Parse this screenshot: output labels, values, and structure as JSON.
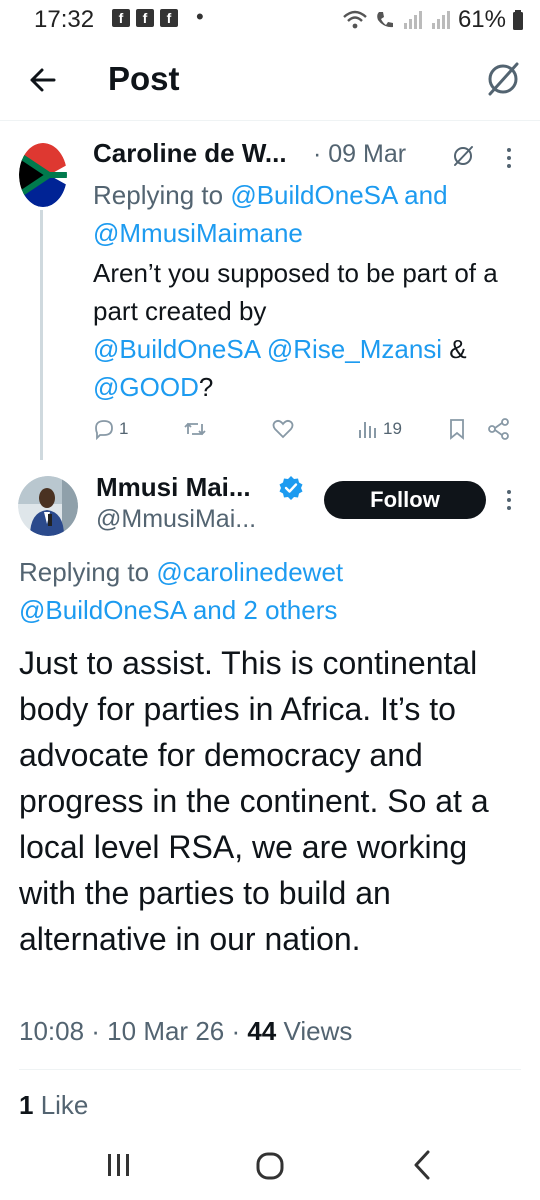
{
  "status_bar": {
    "time": "17:32",
    "notification_icons": [
      "f",
      "f",
      "f"
    ],
    "dot": "•",
    "battery": "61%"
  },
  "header": {
    "back_icon": "arrow-left-icon",
    "title": "Post",
    "grok_icon": "grok-icon"
  },
  "reply_tweet": {
    "author_name": "Caroline de W...",
    "date": "· 09 Mar",
    "replying_prefix": "Replying to ",
    "replying_to_1": "@BuildOneSA",
    "replying_and": " and",
    "replying_to_2": "@MmusiMaimane",
    "body_text": "Aren’t you supposed to be part of a part created by",
    "mention_1": "@BuildOneSA",
    "mention_2": "@Rise_Mzansi",
    "amp": " &",
    "mention_3": "@GOOD",
    "question": "?",
    "actions": {
      "replies": "1",
      "views": "19"
    }
  },
  "main_tweet": {
    "author_name": "Mmusi Mai...",
    "handle": "@MmusiMai...",
    "follow_label": "Follow",
    "replying_prefix": "Replying to ",
    "replying_to_1": "@carolinedewet",
    "replying_to_2": "@BuildOneSA",
    "replying_suffix": " and 2 others",
    "body": "Just to assist. This is continental body for parties in Africa. It’s to advocate for democracy and progress in the continent. So at a local level RSA, we are working with the parties to build an alternative in our nation.",
    "timestamp": "10:08 · 10 Mar 26 · ",
    "views_count": "44",
    "views_label": " Views",
    "likes_count": "1",
    "likes_label": " Like"
  },
  "colors": {
    "link": "#1d9bf0",
    "muted": "#536471",
    "text": "#0f1419"
  }
}
